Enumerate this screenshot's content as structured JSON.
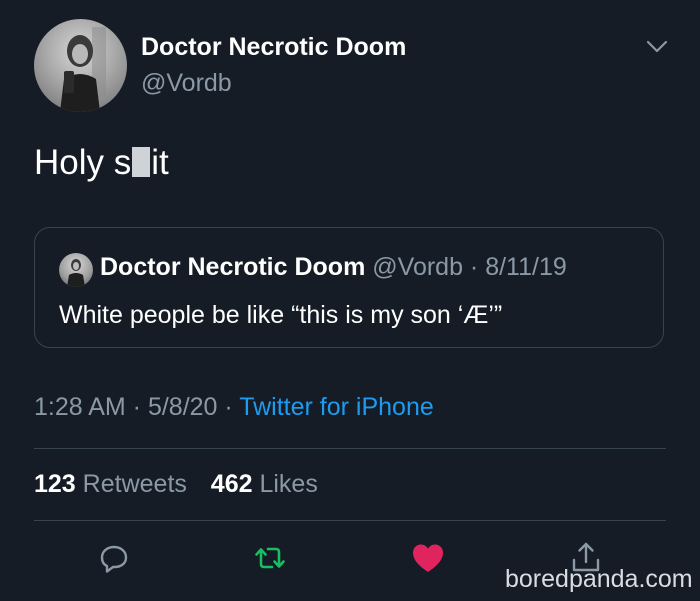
{
  "author": {
    "display_name": "Doctor Necrotic Doom",
    "handle": "@Vordb"
  },
  "tweet": {
    "text_before": "Holy s",
    "text_after": "it"
  },
  "quoted_tweet": {
    "display_name": "Doctor Necrotic Doom",
    "meta": "@Vordb · 8/11/19",
    "text": "White people be like “this is my son ‘Æ’”"
  },
  "meta": {
    "time_date": "1:28 AM · 5/8/20 · ",
    "source": "Twitter for iPhone"
  },
  "stats": {
    "retweets_count": "123",
    "retweets_label": "Retweets",
    "likes_count": "462",
    "likes_label": "Likes"
  },
  "actions": {
    "reply_icon": "reply-icon",
    "retweet_icon": "retweet-icon",
    "like_icon": "heart-icon",
    "share_icon": "share-icon"
  },
  "colors": {
    "background": "#151c26",
    "link": "#1d9bf0",
    "retweet_green": "#17bf63",
    "like_red": "#e0245e",
    "secondary_text": "#8b98a5"
  },
  "watermark": "boredpanda.com"
}
